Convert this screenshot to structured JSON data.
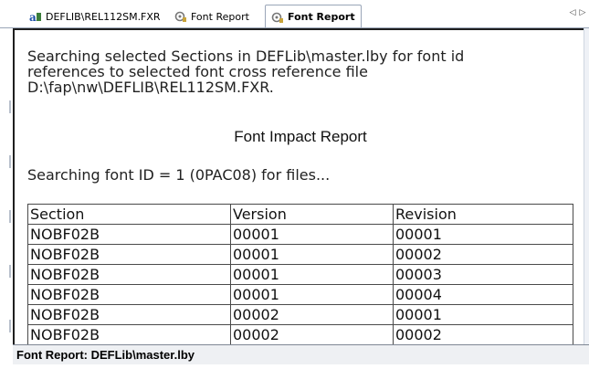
{
  "tabs": [
    {
      "label": "DEFLIB\\REL112SM.FXR",
      "icon": "font-xref-icon",
      "active": false
    },
    {
      "label": "Font Report",
      "icon": "report-gear-icon",
      "active": false
    },
    {
      "label": "Font Report",
      "icon": "report-gear-icon",
      "active": true
    }
  ],
  "nav": {
    "prev": "◁",
    "next": "▷"
  },
  "report": {
    "intro_line1": "Searching selected Sections in DEFLib\\master.lby for font id",
    "intro_line2": "references to selected font cross reference file",
    "intro_line3": "D:\\fap\\nw\\DEFLIB\\REL112SM.FXR.",
    "title": "Font Impact Report",
    "searching": "Searching font ID = 1 (0PAC08) for files...",
    "table": {
      "headers": [
        "Section",
        "Version",
        "Revision"
      ],
      "rows": [
        [
          "NOBF02B",
          "00001",
          "00001"
        ],
        [
          "NOBF02B",
          "00001",
          "00002"
        ],
        [
          "NOBF02B",
          "00001",
          "00003"
        ],
        [
          "NOBF02B",
          "00001",
          "00004"
        ],
        [
          "NOBF02B",
          "00002",
          "00001"
        ],
        [
          "NOBF02B",
          "00002",
          "00002"
        ]
      ]
    }
  },
  "status": {
    "text": "Font Report: DEFLib\\master.lby"
  },
  "colors": {
    "accent": "#9aa6b8",
    "frame": "#1f1f1f",
    "status_bg": "#eef0f3"
  }
}
